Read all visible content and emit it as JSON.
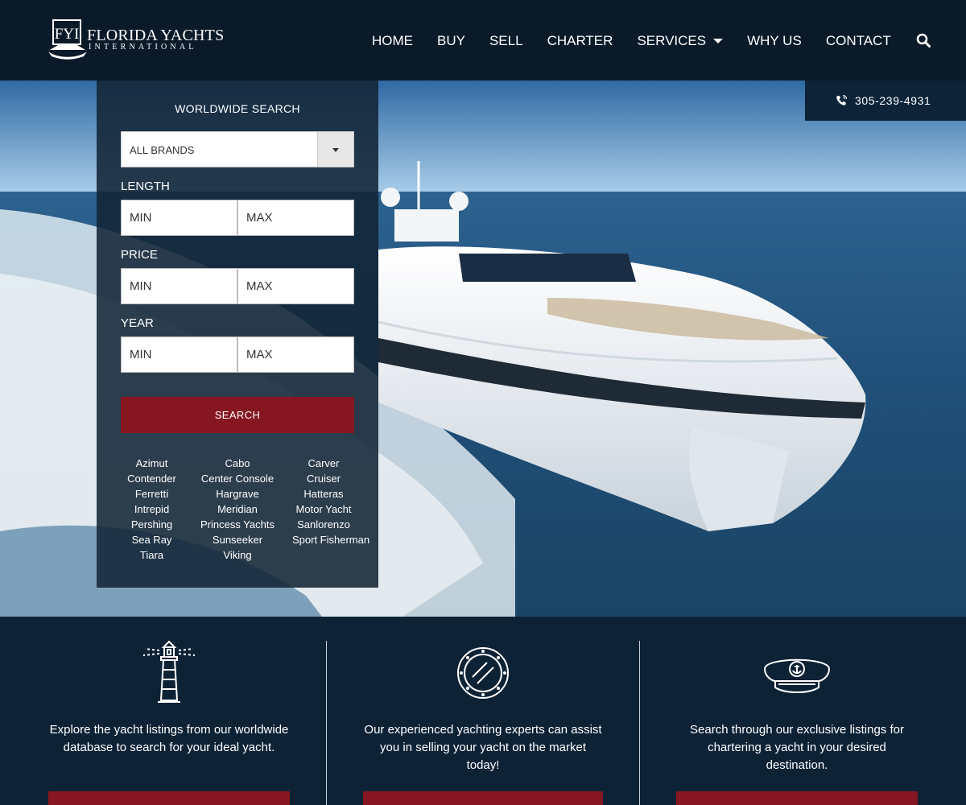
{
  "header": {
    "logo": {
      "mark": "FYI",
      "name": "FLORIDA YACHTS",
      "sub": "INTERNATIONAL"
    },
    "nav": [
      {
        "label": "HOME"
      },
      {
        "label": "BUY"
      },
      {
        "label": "SELL"
      },
      {
        "label": "CHARTER"
      },
      {
        "label": "SERVICES",
        "dropdown": true
      },
      {
        "label": "WHY US"
      },
      {
        "label": "CONTACT"
      }
    ],
    "search_icon": "search-icon"
  },
  "phone": {
    "number": "305-239-4931",
    "icon": "phone-icon"
  },
  "search": {
    "title": "WORLDWIDE SEARCH",
    "brand_select": "ALL BRANDS",
    "length": {
      "label": "LENGTH",
      "min": "MIN",
      "max": "MAX"
    },
    "price": {
      "label": "PRICE",
      "min": "MIN",
      "max": "MAX"
    },
    "year": {
      "label": "YEAR",
      "min": "MIN",
      "max": "MAX"
    },
    "button": "SEARCH",
    "brands": [
      "Azimut",
      "Cabo",
      "Carver",
      "Contender",
      "Center Console",
      "Cruiser",
      "Ferretti",
      "Hargrave",
      "Hatteras",
      "Intrepid",
      "Meridian",
      "Motor Yacht",
      "Pershing",
      "Princess Yachts",
      "Sanlorenzo",
      "Sea Ray",
      "Sunseeker",
      "Sport Fisherman",
      "Tiara",
      "Viking"
    ]
  },
  "features": [
    {
      "icon": "lighthouse-icon",
      "text": "Explore the yacht listings from our worldwide database to search for your ideal yacht."
    },
    {
      "icon": "porthole-icon",
      "text": "Our experienced yachting experts can assist you in selling your yacht on the market today!"
    },
    {
      "icon": "captain-hat-icon",
      "text": "Search through our exclusive listings for chartering a yacht in your desired destination."
    }
  ],
  "colors": {
    "header_bg": "#0a1a29",
    "accent_red": "#861720",
    "section_bg": "#0e2236"
  }
}
